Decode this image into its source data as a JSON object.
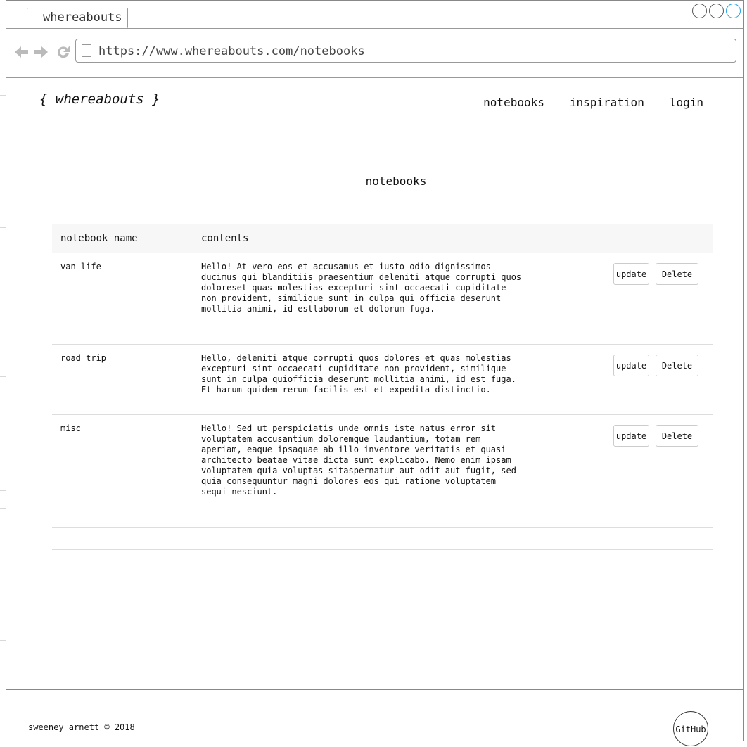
{
  "browser": {
    "tab_title": "whereabouts",
    "url": "https://www.whereabouts.com/notebooks"
  },
  "site": {
    "logo": "{ whereabouts }",
    "nav": [
      "notebooks",
      "inspiration",
      "login"
    ]
  },
  "page": {
    "heading": "notebooks"
  },
  "table": {
    "headers": [
      "notebook name",
      "contents"
    ],
    "rows": [
      {
        "name": "van life",
        "contents": "Hello! At vero eos et accusamus et iusto odio dignissimos\nducimus qui blanditiis praesentium deleniti atque corrupti quos\ndoloreset quas molestias excepturi sint occaecati cupiditate\nnon provident, similique sunt in culpa qui officia deserunt\nmollitia animi, id estlaborum et dolorum fuga.",
        "update_label": "update",
        "delete_label": "Delete"
      },
      {
        "name": "road trip",
        "contents": "Hello, deleniti atque corrupti quos dolores et quas molestias\nexcepturi sint occaecati cupiditate non provident, similique\nsunt in culpa quiofficia deserunt mollitia animi, id est fuga.\nEt harum quidem rerum facilis est et expedita distinctio.",
        "update_label": "update",
        "delete_label": "Delete"
      },
      {
        "name": "misc",
        "contents": "Hello! Sed ut perspiciatis unde omnis iste natus error sit\nvoluptatem accusantium doloremque laudantium, totam rem\naperiam, eaque ipsaquae ab illo inventore veritatis et quasi\narchitecto beatae vitae dicta sunt explicabo. Nemo enim ipsam\nvoluptatem quia voluptas sitaspernatur aut odit aut fugit, sed\nquia consequuntur magni dolores eos qui ratione voluptatem\nsequi nesciunt.",
        "update_label": "update",
        "delete_label": "Delete"
      }
    ]
  },
  "footer": {
    "copyright": "sweeney arnett © 2018",
    "github_label": "GitHub"
  },
  "icons": {
    "back": "back-arrow-icon",
    "forward": "forward-arrow-icon",
    "reload": "reload-icon",
    "page": "page-icon"
  }
}
